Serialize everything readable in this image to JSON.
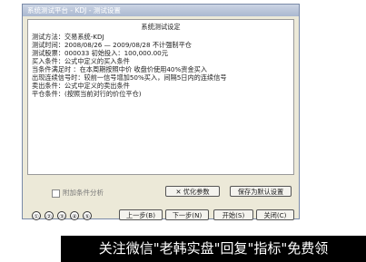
{
  "window": {
    "title": "系统测试平台 - KDJ - 测试设置"
  },
  "summary": {
    "heading": "系统测试设定",
    "lines": [
      "测试方法：交易系统-KDJ",
      "测试时间：2008/08/26 — 2009/08/28    不计强制平仓",
      "测试股票：000033                       初始投入：100,000.00元",
      "买入条件：公式中定义的买入条件",
      "      当条件满足时  ：在本周期按照中价 收盘价使用40%资金买入",
      "      出现连续信号时：较前一信号增加50%买入，间隔5日内的连续信号",
      "卖出条件：公式中定义的卖出条件",
      "平仓条件：(按照当前对行的价位平仓)"
    ]
  },
  "checkbox": {
    "label": "附加条件分析"
  },
  "buttons": {
    "optimize": "✕ 优化参数",
    "save_default": "保存为默认设置",
    "prev": "上一步(B)",
    "next": "下一步(N)",
    "start": "开始(S)",
    "close": "关闭(C)"
  },
  "steps": [
    "①",
    "②",
    "③",
    "④",
    "⑤"
  ],
  "banner": {
    "text": "关注微信\"老韩实盘\"回复\"指标\"免费领"
  }
}
